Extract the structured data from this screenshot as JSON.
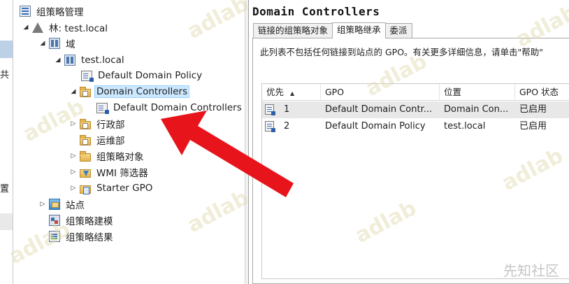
{
  "background_window": {
    "text_1": "共",
    "text_2": "置"
  },
  "tree": {
    "root": "组策略管理",
    "forest": "林: test.local",
    "domains": "域",
    "domain": "test.local",
    "default_domain_policy": "Default Domain Policy",
    "domain_controllers": "Domain Controllers",
    "default_dc_policy": "Default Domain Controllers",
    "ou_admin": "行政部",
    "ou_ops": "运维部",
    "gpo_objects": "组策略对象",
    "wmi_filters": "WMI 筛选器",
    "starter_gpo": "Starter GPO",
    "sites": "站点",
    "modeling": "组策略建模",
    "results": "组策略结果"
  },
  "right": {
    "title": "Domain Controllers",
    "tabs": [
      "链接的组策略对象",
      "组策略继承",
      "委派"
    ],
    "active_tab": 1,
    "info": "此列表不包括任何链接到站点的 GPO。有关更多详细信息，请单击\"帮助\""
  },
  "grid": {
    "columns": [
      "优先",
      "GPO",
      "位置",
      "GPO 状态"
    ],
    "sort_column": 0,
    "sort_direction": "ascending",
    "rows": [
      {
        "order": "1",
        "gpo": "Default Domain Contr...",
        "location": "Domain Con...",
        "status": "已启用"
      },
      {
        "order": "2",
        "gpo": "Default Domain Policy",
        "location": "test.local",
        "status": "已启用"
      }
    ]
  },
  "watermarks": [
    "adlab",
    "adlab",
    "adlab",
    "adlab",
    "adlab",
    "adlab",
    "adlab",
    "adlab"
  ],
  "footer_mark": "先知社区",
  "colors": {
    "selection": "#cce8ff",
    "arrow": "#e8141c",
    "row_selected": "#e8e8e8"
  }
}
